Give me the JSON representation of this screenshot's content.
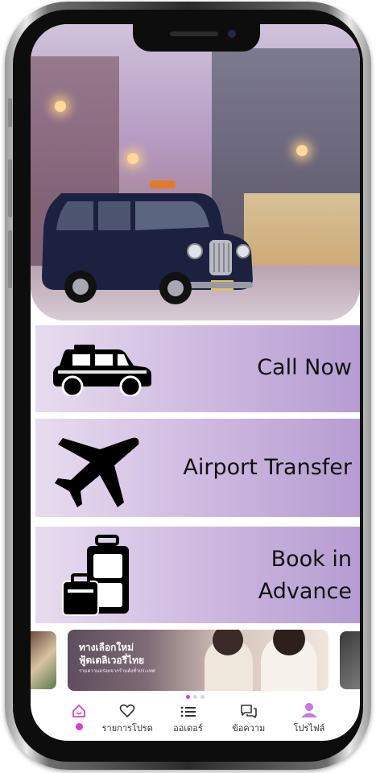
{
  "services": {
    "call_now": "Call Now",
    "airport_transfer": "Airport Transfer",
    "book_line1": "Book in",
    "book_line2": "Advance"
  },
  "banner": {
    "title_line1": "ทางเลือกใหม่",
    "title_line2": "ฟู้ดเดลิเวอรี่ไทย",
    "subtitle": "รวมความอร่อยจากร้านดังทั่วประเทศ"
  },
  "carousel": {
    "active_index": 0,
    "count": 3
  },
  "nav": {
    "home_icon": "home-icon",
    "favorites_label": "รายการโปรด",
    "orders_label": "ออเดอร์",
    "messages_label": "ข้อความ",
    "profile_label": "โปรไฟล์"
  },
  "colors": {
    "accent": "#d83fd0",
    "card_gradient_start": "#e7dcef",
    "card_gradient_end": "#b69cd2"
  }
}
